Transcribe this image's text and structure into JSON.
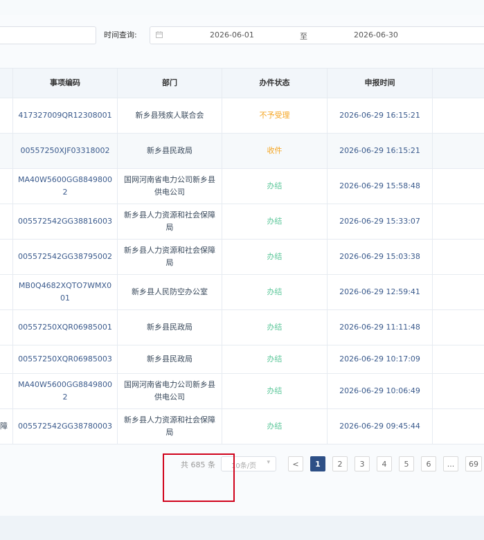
{
  "filters": {
    "time_label": "时间查询:",
    "start_date": "2026-06-01",
    "separator": "至",
    "end_date": "2026-06-30"
  },
  "table": {
    "headers": [
      "事项编码",
      "部门",
      "办件状态",
      "申报时间"
    ],
    "rows": [
      {
        "code": "417327009QR12308001",
        "dept": "新乡县残疾人联合会",
        "status": "不予受理",
        "time": "2026-06-29 16:15:21"
      },
      {
        "code": "00557250XJF03318002",
        "dept": "新乡县民政局",
        "status": "收件",
        "time": "2026-06-29 16:15:21"
      },
      {
        "code": "MA40W5600GG88498002",
        "dept": "国网河南省电力公司新乡县供电公司",
        "status": "办结",
        "time": "2026-06-29 15:58:48"
      },
      {
        "code": "005572542GG38816003",
        "dept": "新乡县人力资源和社会保障局",
        "status": "办结",
        "time": "2026-06-29 15:33:07"
      },
      {
        "code": "005572542GG38795002",
        "dept": "新乡县人力资源和社会保障局",
        "status": "办结",
        "time": "2026-06-29 15:03:38"
      },
      {
        "code": "MB0Q4682XQTO7WMX001",
        "dept": "新乡县人民防空办公室",
        "status": "办结",
        "time": "2026-06-29 12:59:41"
      },
      {
        "code": "00557250XQR06985001",
        "dept": "新乡县民政局",
        "status": "办结",
        "time": "2026-06-29 11:11:48"
      },
      {
        "code": "00557250XQR06985003",
        "dept": "新乡县民政局",
        "status": "办结",
        "time": "2026-06-29 10:17:09"
      },
      {
        "code": "MA40W5600GG88498002",
        "dept": "国网河南省电力公司新乡县供电公司",
        "status": "办结",
        "time": "2026-06-29 10:06:49"
      },
      {
        "code": "005572542GG38780003",
        "dept": "新乡县人力资源和社会保障局",
        "status": "办结",
        "time": "2026-06-29 09:45:44"
      }
    ],
    "row10_cut_text": "障"
  },
  "pagination": {
    "total": "共 685 条",
    "page_size": "10条/页",
    "prev": "<",
    "pages": [
      "1",
      "2",
      "3",
      "4",
      "5",
      "6",
      "...",
      "69"
    ]
  },
  "colors": {
    "status_rejected": "#f5a623",
    "status_received": "#f5a623",
    "status_done": "#5cc79a",
    "active_page": "#2d4f86",
    "highlight_box": "#d0021b"
  }
}
